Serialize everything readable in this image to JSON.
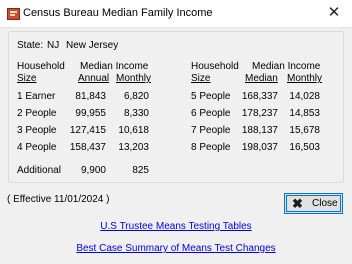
{
  "window": {
    "title": "Census Bureau Median Family Income",
    "close_glyph": "✕"
  },
  "state": {
    "label": "State:",
    "code": "NJ",
    "name": "New Jersey"
  },
  "left_table": {
    "header1": {
      "household": "Household",
      "median": "Median Income"
    },
    "header2": {
      "size": "Size",
      "annual": "Annual",
      "monthly": "Monthly"
    },
    "rows": [
      {
        "label": "1 Earner",
        "annual": "81,843",
        "monthly": "6,820"
      },
      {
        "label": "2 People",
        "annual": "99,955",
        "monthly": "8,330"
      },
      {
        "label": "3 People",
        "annual": "127,415",
        "monthly": "10,618"
      },
      {
        "label": "4 People",
        "annual": "158,437",
        "monthly": "13,203"
      }
    ],
    "additional": {
      "label": "Additional",
      "annual": "9,900",
      "monthly": "825"
    }
  },
  "right_table": {
    "header1": {
      "household": "Household",
      "median": "Median Income"
    },
    "header2": {
      "size": "Size",
      "median": "Median",
      "monthly": "Monthly"
    },
    "rows": [
      {
        "label": "5 People",
        "median": "168,337",
        "monthly": "14,028"
      },
      {
        "label": "6 People",
        "median": "178,237",
        "monthly": "14,853"
      },
      {
        "label": "7 People",
        "median": "188,137",
        "monthly": "15,678"
      },
      {
        "label": "8 People",
        "median": "198,037",
        "monthly": "16,503"
      }
    ]
  },
  "effective": "( Effective 11/01/2024 )",
  "close_button": {
    "icon": "x-icon",
    "label": "Close"
  },
  "links": {
    "trustee": "U.S Trustee Means Testing Tables",
    "best_case": "Best Case Summary of Means Test Changes"
  }
}
